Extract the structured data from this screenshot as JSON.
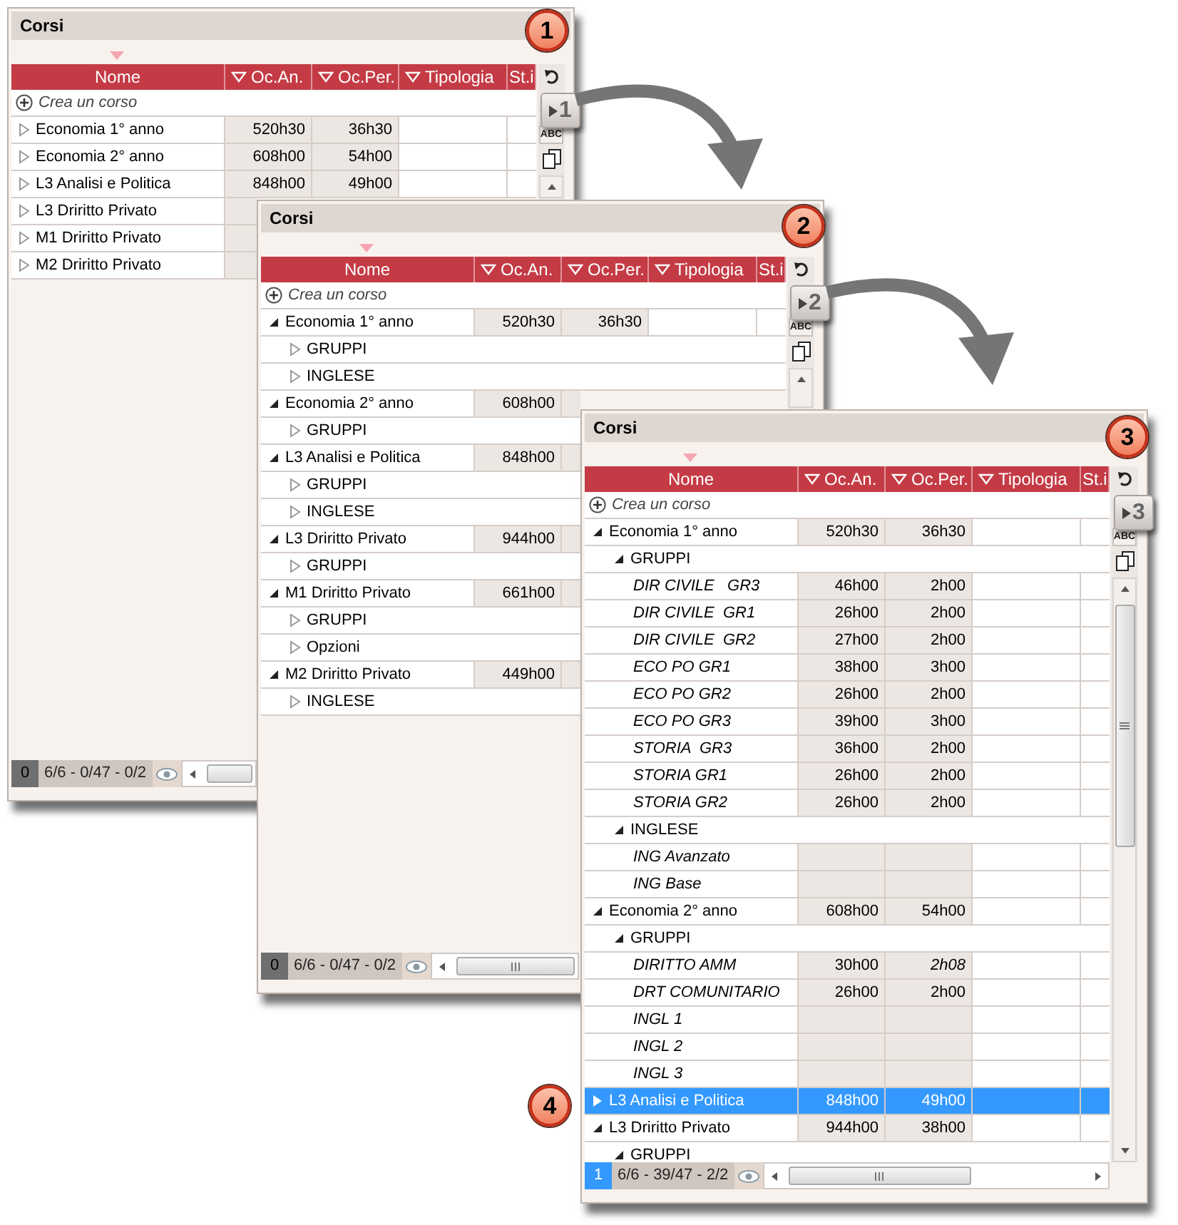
{
  "windows": [
    {
      "title": "Corsi",
      "columns": [
        "Nome",
        "Oc.An.",
        "Oc.Per.",
        "Tipologia",
        "St.i"
      ],
      "step_button": "1",
      "spell_button": "ABC",
      "create_label": "Crea un corso",
      "rows": [
        {
          "kind": "course",
          "name": "Economia 1° anno",
          "expanded": false,
          "selected": false,
          "oc_an": "520h30",
          "oc_per": "36h30"
        },
        {
          "kind": "course",
          "name": "Economia 2° anno",
          "expanded": false,
          "selected": false,
          "oc_an": "608h00",
          "oc_per": "54h00"
        },
        {
          "kind": "course",
          "name": "L3 Analisi e Politica",
          "expanded": false,
          "selected": false,
          "oc_an": "848h00",
          "oc_per": "49h00"
        },
        {
          "kind": "course",
          "name": "L3 Driritto Privato",
          "expanded": false,
          "selected": false
        },
        {
          "kind": "course",
          "name": "M1 Driritto Privato",
          "expanded": false,
          "selected": false
        },
        {
          "kind": "course",
          "name": "M2 Driritto Privato",
          "expanded": false,
          "selected": false
        }
      ],
      "footer": {
        "count": "0",
        "highlighted": false,
        "summary": "6/6 - 0/47 - 0/2"
      }
    },
    {
      "title": "Corsi",
      "columns": [
        "Nome",
        "Oc.An.",
        "Oc.Per.",
        "Tipologia",
        "St.i"
      ],
      "step_button": "2",
      "spell_button": "ABC",
      "create_label": "Crea un corso",
      "rows": [
        {
          "kind": "course",
          "name": "Economia 1° anno",
          "expanded": true,
          "selected": false,
          "oc_an": "520h30",
          "oc_per": "36h30",
          "children": [
            {
              "kind": "folder",
              "name": "GRUPPI",
              "expanded": false,
              "selected": false
            },
            {
              "kind": "folder",
              "name": "INGLESE",
              "expanded": false,
              "selected": false
            }
          ]
        },
        {
          "kind": "course",
          "name": "Economia 2° anno",
          "expanded": true,
          "selected": false,
          "oc_an": "608h00",
          "children": [
            {
              "kind": "folder",
              "name": "GRUPPI",
              "expanded": false,
              "selected": false
            }
          ]
        },
        {
          "kind": "course",
          "name": "L3 Analisi e Politica",
          "expanded": true,
          "selected": false,
          "oc_an": "848h00",
          "children": [
            {
              "kind": "folder",
              "name": "GRUPPI",
              "expanded": false,
              "selected": false
            },
            {
              "kind": "folder",
              "name": "INGLESE",
              "expanded": false,
              "selected": false
            }
          ]
        },
        {
          "kind": "course",
          "name": "L3 Driritto Privato",
          "expanded": true,
          "selected": false,
          "oc_an": "944h00",
          "children": [
            {
              "kind": "folder",
              "name": "GRUPPI",
              "expanded": false,
              "selected": false
            }
          ]
        },
        {
          "kind": "course",
          "name": "M1 Driritto Privato",
          "expanded": true,
          "selected": false,
          "oc_an": "661h00",
          "children": [
            {
              "kind": "folder",
              "name": "GRUPPI",
              "expanded": false,
              "selected": false
            },
            {
              "kind": "folder",
              "name": "Opzioni",
              "expanded": false,
              "selected": false
            }
          ]
        },
        {
          "kind": "course",
          "name": "M2 Driritto Privato",
          "expanded": true,
          "selected": false,
          "oc_an": "449h00",
          "children": [
            {
              "kind": "folder",
              "name": "INGLESE",
              "expanded": false,
              "selected": false
            }
          ]
        }
      ],
      "footer": {
        "count": "0",
        "highlighted": false,
        "summary": "6/6 - 0/47 - 0/2"
      }
    },
    {
      "title": "Corsi",
      "columns": [
        "Nome",
        "Oc.An.",
        "Oc.Per.",
        "Tipologia",
        "St.i"
      ],
      "step_button": "3",
      "spell_button": "ABC",
      "create_label": "Crea un corso",
      "rows": [
        {
          "kind": "course",
          "name": "Economia 1° anno",
          "expanded": true,
          "selected": false,
          "oc_an": "520h30",
          "oc_per": "36h30",
          "children": [
            {
              "kind": "folder",
              "name": "GRUPPI",
              "expanded": true,
              "selected": false,
              "children": [
                {
                  "kind": "item",
                  "name": "DIR CIVILE   GR3",
                  "selected": false,
                  "oc_an": "46h00",
                  "oc_per": "2h00"
                },
                {
                  "kind": "item",
                  "name": "DIR CIVILE  GR1",
                  "selected": false,
                  "oc_an": "26h00",
                  "oc_per": "2h00"
                },
                {
                  "kind": "item",
                  "name": "DIR CIVILE  GR2",
                  "selected": false,
                  "oc_an": "27h00",
                  "oc_per": "2h00"
                },
                {
                  "kind": "item",
                  "name": "ECO PO GR1",
                  "selected": false,
                  "oc_an": "38h00",
                  "oc_per": "3h00"
                },
                {
                  "kind": "item",
                  "name": "ECO PO GR2",
                  "selected": false,
                  "oc_an": "26h00",
                  "oc_per": "2h00"
                },
                {
                  "kind": "item",
                  "name": "ECO PO GR3",
                  "selected": false,
                  "oc_an": "39h00",
                  "oc_per": "3h00"
                },
                {
                  "kind": "item",
                  "name": "STORIA  GR3",
                  "selected": false,
                  "oc_an": "36h00",
                  "oc_per": "2h00"
                },
                {
                  "kind": "item",
                  "name": "STORIA GR1",
                  "selected": false,
                  "oc_an": "26h00",
                  "oc_per": "2h00"
                },
                {
                  "kind": "item",
                  "name": "STORIA GR2",
                  "selected": false,
                  "oc_an": "26h00",
                  "oc_per": "2h00"
                }
              ]
            },
            {
              "kind": "folder",
              "name": "INGLESE",
              "expanded": true,
              "selected": false,
              "children": [
                {
                  "kind": "item",
                  "name": "ING Avanzato",
                  "selected": false
                },
                {
                  "kind": "item",
                  "name": "ING Base",
                  "selected": false
                }
              ]
            }
          ]
        },
        {
          "kind": "course",
          "name": "Economia 2° anno",
          "expanded": true,
          "selected": false,
          "oc_an": "608h00",
          "oc_per": "54h00",
          "children": [
            {
              "kind": "folder",
              "name": "GRUPPI",
              "expanded": true,
              "selected": false,
              "children": [
                {
                  "kind": "item",
                  "name": "DIRITTO AMM",
                  "selected": false,
                  "oc_an": "30h00",
                  "oc_per": "2h08",
                  "oc_per_italic": true
                },
                {
                  "kind": "item",
                  "name": "DRT COMUNITARIO",
                  "selected": false,
                  "oc_an": "26h00",
                  "oc_per": "2h00"
                },
                {
                  "kind": "item",
                  "name": "INGL 1",
                  "selected": false
                },
                {
                  "kind": "item",
                  "name": "INGL 2",
                  "selected": false
                },
                {
                  "kind": "item",
                  "name": "INGL 3",
                  "selected": false
                }
              ]
            }
          ]
        },
        {
          "kind": "course",
          "name": "L3 Analisi e Politica",
          "expanded": false,
          "selected": true,
          "oc_an": "848h00",
          "oc_per": "49h00"
        },
        {
          "kind": "course",
          "name": "L3 Driritto Privato",
          "expanded": true,
          "selected": false,
          "oc_an": "944h00",
          "oc_per": "38h00",
          "children": [
            {
              "kind": "folder",
              "name": "GRUPPI",
              "expanded": true,
              "selected": false
            }
          ]
        }
      ],
      "footer": {
        "count": "1",
        "highlighted": true,
        "summary": "6/6 - 39/47 - 2/2"
      }
    }
  ],
  "callouts": [
    "1",
    "2",
    "3",
    "4"
  ]
}
